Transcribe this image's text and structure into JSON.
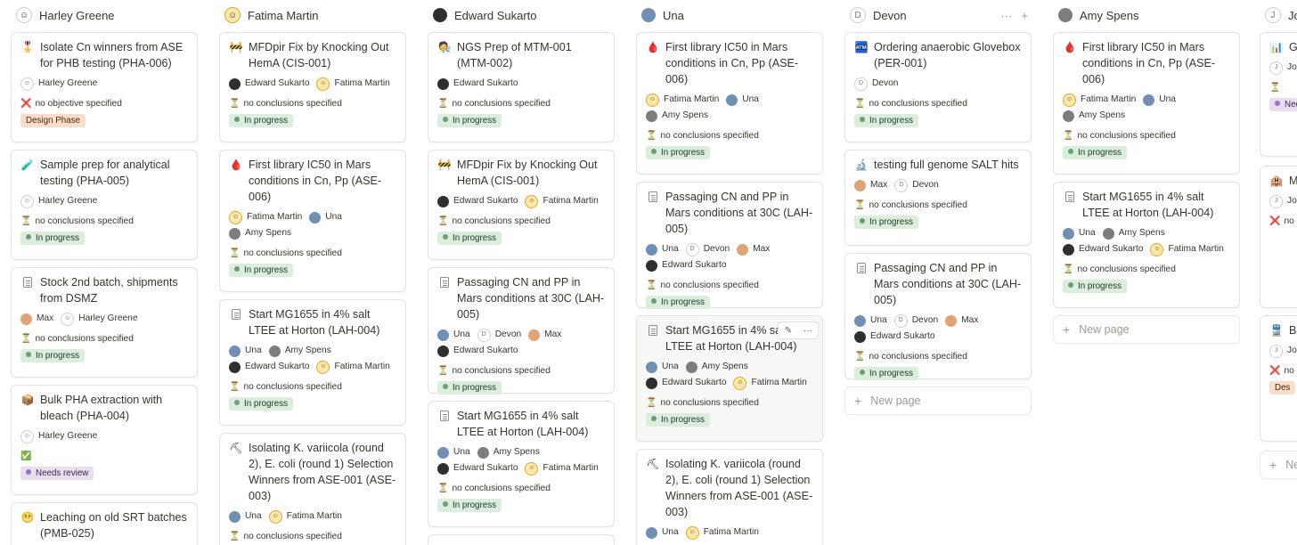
{
  "people": {
    "hg": "Harley Greene",
    "fm": "Fatima Martin",
    "es": "Edward Sukarto",
    "un": "Una",
    "as": "Amy Spens",
    "dv": "Devon",
    "mx": "Max",
    "jn": "Jon"
  },
  "common": {
    "no_conclusions": "no conclusions specified",
    "no_objective": "no objective specified",
    "new_page": "New page",
    "in_progress": "In progress",
    "design_phase": "Design Phase",
    "needs_review": "Needs review"
  },
  "columns": [
    {
      "name": "Harley Greene"
    },
    {
      "name": "Fatima Martin"
    },
    {
      "name": "Edward Sukarto"
    },
    {
      "name": "Una"
    },
    {
      "name": "Devon"
    },
    {
      "name": "Amy Spens"
    },
    {
      "name": "Jo"
    }
  ],
  "cards": {
    "c1_1": "Isolate Cn winners from ASE for PHB testing (PHA-006)",
    "c1_2": "Sample prep for analytical testing (PHA-005)",
    "c1_3": "Stock 2nd batch, shipments from DSMZ",
    "c1_4": "Bulk PHA extraction with bleach (PHA-004)",
    "c1_5": "Leaching on old SRT batches (PMB-025)",
    "c2_1": "MFDpir Fix by Knocking Out HemA (CIS-001)",
    "c2_2": "First library IC50 in Mars conditions in Cn, Pp (ASE-006)",
    "c2_3": "Start MG1655 in 4% salt LTEE at Horton (LAH-004)",
    "c2_4": "Isolating K. variicola (round 2), E. coli (round 1) Selection Winners from ASE-001  (ASE-003)",
    "c3_1": "NGS Prep of MTM-001 (MTM-002)",
    "c3_2": "MFDpir Fix by Knocking Out HemA (CIS-001)",
    "c3_3": "Passaging CN and PP in Mars conditions at 30C (LAH-005)",
    "c3_4": "Start MG1655 in 4% salt LTEE at Horton (LAH-004)",
    "c4_1": "First library IC50 in Mars conditions in Cn, Pp (ASE-006)",
    "c4_2": "Passaging CN and PP in Mars conditions at 30C (LAH-005)",
    "c4_3": "Start MG1655 in 4% salt LTEE at Horton (LAH-004)",
    "c4_4": "Isolating K. variicola (round 2), E. coli (round 1) Selection Winners from ASE-001  (ASE-003)",
    "c5_1": "Ordering anaerobic Glovebox (PER-001)",
    "c5_2": "testing full genome SALT hits",
    "c5_3": "Passaging CN and PP in Mars conditions at 30C (LAH-005)",
    "c6_1": "First library IC50 in Mars conditions in Cn, Pp (ASE-006)",
    "c6_2": "Start MG1655 in 4% salt LTEE at Horton (LAH-004)",
    "c7_1": "Gr Cl Co",
    "c7_2": "Mi Mo Ar QI",
    "c7_3": "Ba Ar (M"
  },
  "col7": {
    "person": "Jon",
    "needs": "Nee",
    "no_o": "no o",
    "des": "Des",
    "ne": "Ne"
  }
}
